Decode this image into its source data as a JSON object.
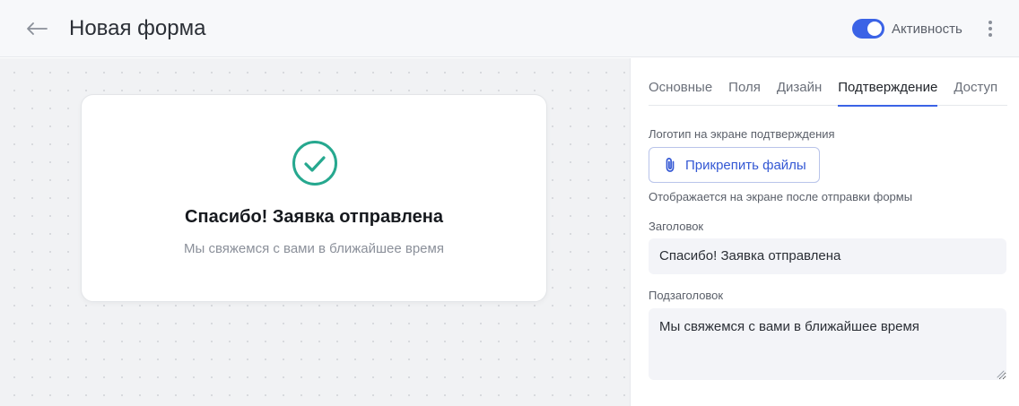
{
  "header": {
    "title": "Новая форма",
    "toggle_label": "Активность",
    "toggle_on": true
  },
  "preview": {
    "title": "Спасибо! Заявка отправлена",
    "subtitle": "Мы свяжемся с вами в ближайшее время"
  },
  "tabs": [
    {
      "label": "Основные",
      "active": false
    },
    {
      "label": "Поля",
      "active": false
    },
    {
      "label": "Дизайн",
      "active": false
    },
    {
      "label": "Подтверждение",
      "active": true
    },
    {
      "label": "Доступ",
      "active": false
    }
  ],
  "settings": {
    "logo_label": "Логотип на экране подтверждения",
    "attach_label": "Прикрепить файлы",
    "logo_hint": "Отображается на экране после отправки формы",
    "heading_label": "Заголовок",
    "heading_value": "Спасибо! Заявка отправлена",
    "subheading_label": "Подзаголовок",
    "subheading_value": "Мы свяжемся с вами в ближайшее время"
  },
  "colors": {
    "accent": "#3b63e6",
    "success": "#26a88f"
  }
}
